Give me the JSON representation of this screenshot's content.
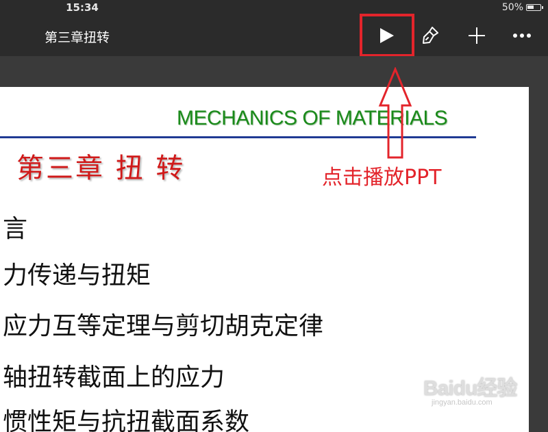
{
  "status_bar": {
    "time": "15:34",
    "battery": "50%"
  },
  "toolbar": {
    "title": "第三章扭转",
    "icons": {
      "play": "play-icon",
      "paint": "paintbrush-icon",
      "add": "plus-icon",
      "more": "more-icon"
    }
  },
  "slide": {
    "header": "MECHANICS OF MATERIALS",
    "title": "第三章 扭 转",
    "items": [
      "言",
      "力传递与扭矩",
      "应力互等定理与剪切胡克定律",
      "轴扭转截面上的应力",
      "惯性矩与抗扭截面系数"
    ]
  },
  "annotation": {
    "text": "点击播放PPT",
    "color": "#e3242b"
  },
  "watermark": {
    "logo": "Baidu经验",
    "url": "jingyan.baidu.com"
  },
  "colors": {
    "toolbar_bg": "#2b2b2b",
    "slide_header": "#1a8a1a",
    "slide_title": "#d01a1a",
    "rule": "#1f3a93"
  }
}
